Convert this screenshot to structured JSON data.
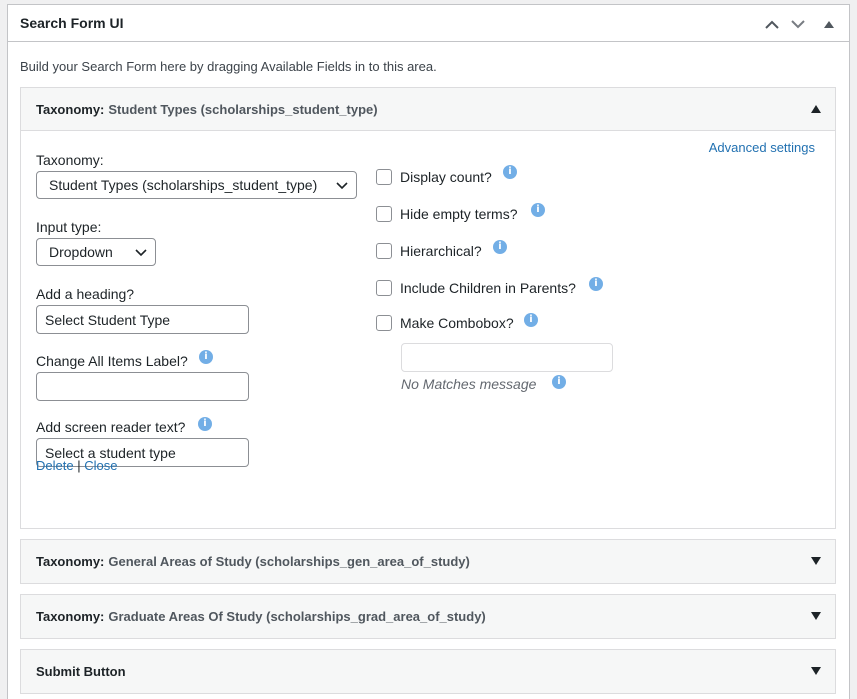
{
  "box": {
    "title": "Search Form UI",
    "description": "Build your Search Form here by dragging Available Fields in to this area."
  },
  "expanded_panel": {
    "type_label": "Taxonomy:",
    "name": "Student Types (scholarships_student_type)",
    "advanced_link": "Advanced settings",
    "taxonomy_label": "Taxonomy:",
    "taxonomy_value": "Student Types (scholarships_student_type)",
    "input_type_label": "Input type:",
    "input_type_value": "Dropdown",
    "heading_label": "Add a heading?",
    "heading_value": "Select Student Type",
    "all_items_label": "Change All Items Label?",
    "all_items_value": "",
    "screen_reader_label": "Add screen reader text?",
    "screen_reader_value": "Select a student type",
    "checkboxes": [
      {
        "label": "Display count?",
        "checked": false
      },
      {
        "label": "Hide empty terms?",
        "checked": false
      },
      {
        "label": "Hierarchical?",
        "checked": false
      },
      {
        "label": "Include Children in Parents?",
        "checked": false
      },
      {
        "label": "Make Combobox?",
        "checked": false
      }
    ],
    "no_matches_value": "",
    "no_matches_hint": "No Matches message",
    "delete_link": "Delete",
    "separator": "|",
    "close_link": "Close"
  },
  "collapsed_panels": [
    {
      "type_label": "Taxonomy:",
      "name": "General Areas of Study (scholarships_gen_area_of_study)"
    },
    {
      "type_label": "Taxonomy:",
      "name": "Graduate Areas Of Study (scholarships_grad_area_of_study)"
    },
    {
      "type_label": "Submit Button",
      "name": ""
    }
  ],
  "icons": {
    "move_up": "chevron-up-icon",
    "move_down": "chevron-down-icon",
    "toggle": "triangle-up-icon",
    "info": "info-icon"
  },
  "colors": {
    "link": "#2271b1",
    "info": "#72aee6",
    "border": "#c3c4c7"
  }
}
